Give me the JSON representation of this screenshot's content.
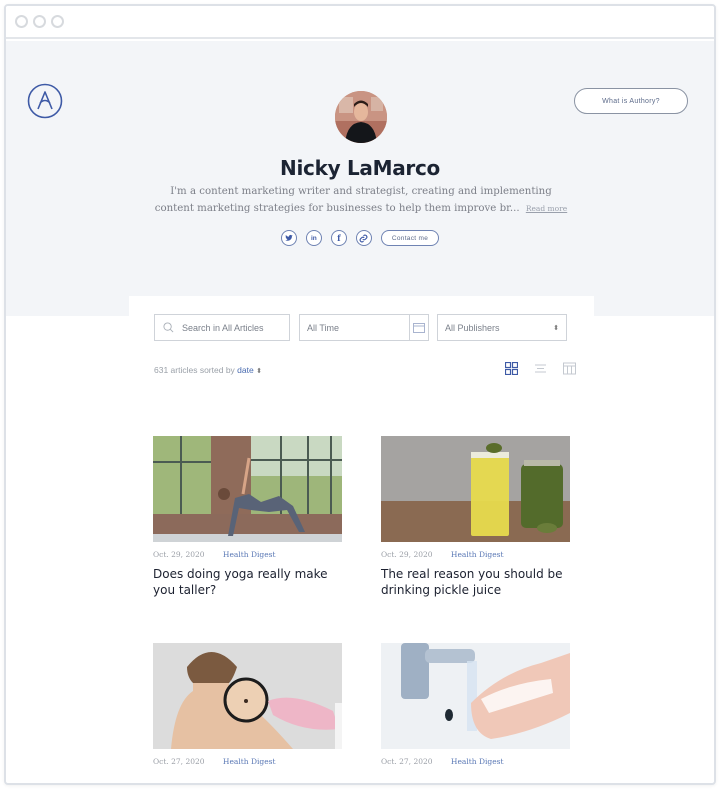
{
  "window": {
    "controls": [
      "close",
      "minimize",
      "maximize"
    ]
  },
  "header": {
    "logo_icon": "authory-logo-icon",
    "what_is_button": "What is Authory?"
  },
  "profile": {
    "name": "Nicky LaMarco",
    "bio": "I'm a content marketing writer and strategist, creating and implementing content marketing strategies for businesses to help them improve br...",
    "read_more": "Read more",
    "social": [
      {
        "name": "twitter",
        "glyph": "t"
      },
      {
        "name": "linkedin",
        "glyph": "in"
      },
      {
        "name": "facebook",
        "glyph": "f"
      },
      {
        "name": "website-link",
        "glyph": "∞"
      }
    ],
    "contact_button": "Contact me"
  },
  "filters": {
    "search_placeholder": "Search in All Articles",
    "time_value": "All Time",
    "publisher_value": "All Publishers",
    "sort_prefix": "631 articles sorted by",
    "sort_key": "date",
    "sort_arrows": "⬍",
    "views": [
      "grid-view",
      "list-view",
      "table-view"
    ],
    "active_view": "grid-view"
  },
  "articles": [
    {
      "date": "Oct. 29, 2020",
      "publisher": "Health Digest",
      "title": "Does doing yoga really make you taller?",
      "image": "yoga-woman-photo"
    },
    {
      "date": "Oct. 29, 2020",
      "publisher": "Health Digest",
      "title": "The real reason you should be drinking pickle juice",
      "image": "pickle-juice-photo"
    },
    {
      "date": "Oct. 27, 2020",
      "publisher": "Health Digest",
      "title": "",
      "image": "mole-check-photo"
    },
    {
      "date": "Oct. 27, 2020",
      "publisher": "Health Digest",
      "title": "",
      "image": "hand-washing-photo"
    }
  ],
  "colors": {
    "accent": "#3e5aa6",
    "hero_bg": "#f3f5f8",
    "link": "#4a6cb0"
  }
}
